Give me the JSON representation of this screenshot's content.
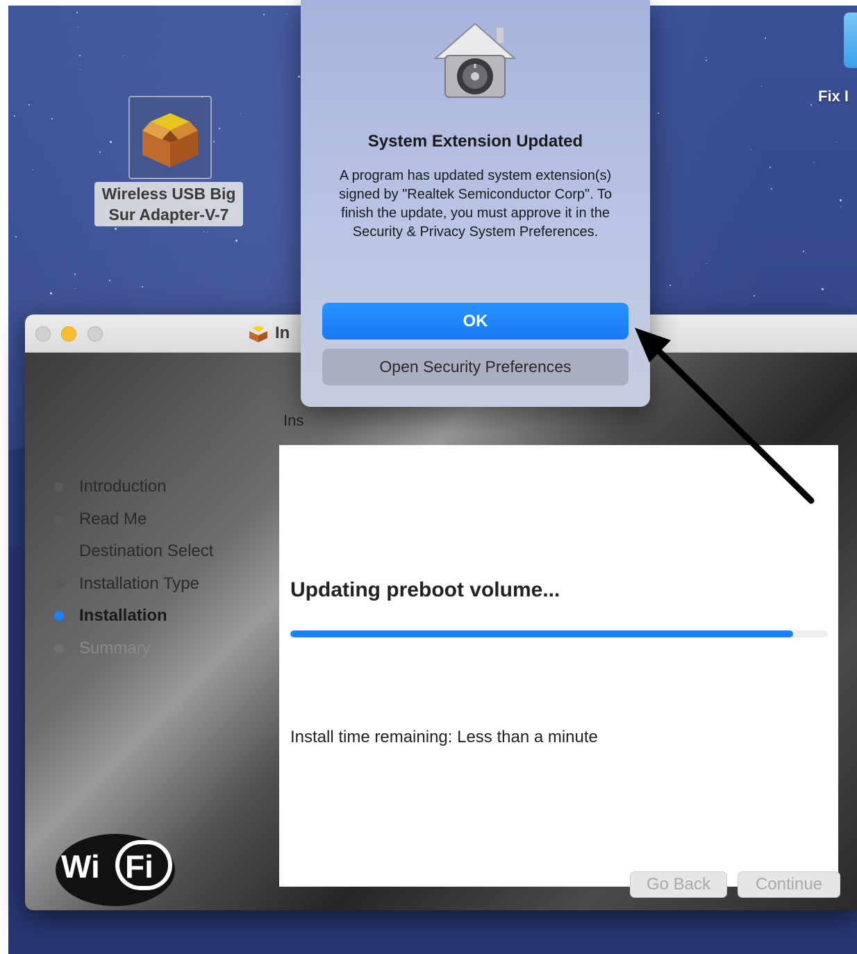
{
  "desktop": {
    "package_label_line1": "Wireless USB Big",
    "package_label_line2": "Sur Adapter-V-7",
    "folder_label": "Fix I"
  },
  "installer": {
    "title": "In",
    "subtitle": "Ins",
    "steps": [
      {
        "label": "Introduction",
        "state": "done"
      },
      {
        "label": "Read Me",
        "state": "done"
      },
      {
        "label": "Destination Select",
        "state": "done"
      },
      {
        "label": "Installation Type",
        "state": "done"
      },
      {
        "label": "Installation",
        "state": "active"
      },
      {
        "label": "Summary",
        "state": "future"
      }
    ],
    "status_text": "Updating preboot volume...",
    "progress_fraction": 0.935,
    "time_remaining": "Install time remaining: Less than a minute",
    "go_back_label": "Go Back",
    "continue_label": "Continue",
    "logo_text": "WiFi"
  },
  "alert": {
    "title": "System Extension Updated",
    "message": "A program has updated system extension(s) signed by \"Realtek Semiconductor Corp\". To finish the update, you must approve it in the Security & Privacy System Preferences.",
    "ok_label": "OK",
    "secondary_label": "Open Security Preferences"
  },
  "colors": {
    "accent": "#1a82ff",
    "desktop_blue": "#34488a",
    "minimize_yellow": "#f6bd2f"
  }
}
